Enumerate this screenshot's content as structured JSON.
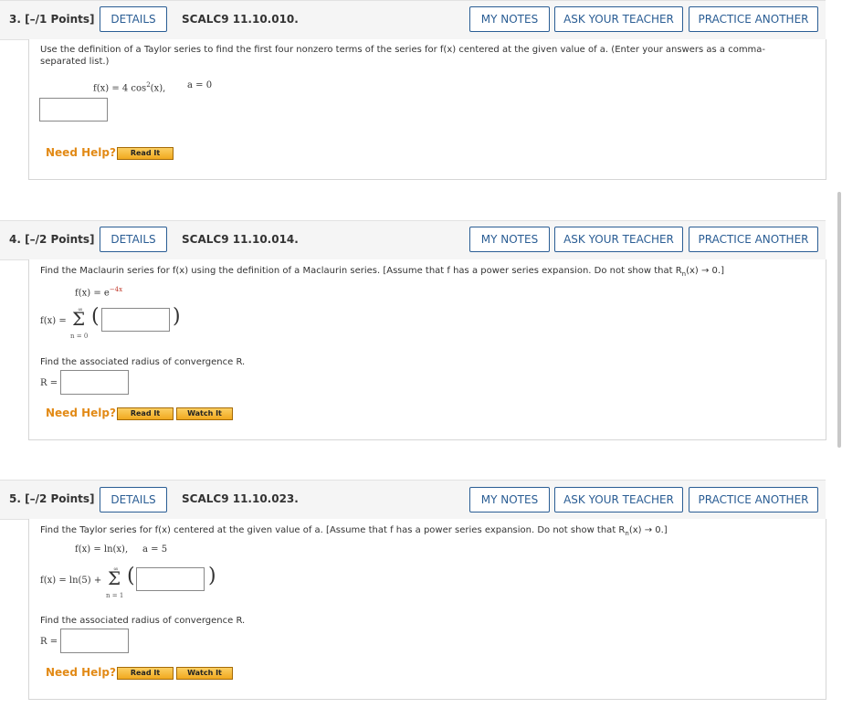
{
  "q3": {
    "num": "3.  [–/1 Points]",
    "details": "DETAILS",
    "code": "SCALC9 11.10.010.",
    "my_notes": "MY NOTES",
    "ask": "ASK YOUR TEACHER",
    "practice": "PRACTICE ANOTHER",
    "instr": "Use the definition of a Taylor series to find the first four nonzero terms of the series for f(x) centered at the given value of a. (Enter your answers as a comma-separated list.)",
    "fx_pre": "f(x) = 4 cos",
    "fx_sup": "2",
    "fx_post": "(x),",
    "a": "a = 0",
    "need_help": "Need Help?",
    "read_it": "Read It"
  },
  "q4": {
    "num": "4.  [–/2 Points]",
    "details": "DETAILS",
    "code": "SCALC9 11.10.014.",
    "my_notes": "MY NOTES",
    "ask": "ASK YOUR TEACHER",
    "practice": "PRACTICE ANOTHER",
    "instr": "Find the Maclaurin series for f(x) using the definition of a Maclaurin series. [Assume that f has a power series expansion. Do not show that R",
    "instr_sub": "n",
    "instr_end": "(x) → 0.]",
    "fx": "f(x) = e",
    "fx_sup": "−4x",
    "sum_lhs": "f(x) =",
    "sum_top": "∞",
    "sum_bottom": "n = 0",
    "radius_text": "Find the associated radius of convergence R.",
    "r_label": "R =",
    "need_help": "Need Help?",
    "read_it": "Read It",
    "watch_it": "Watch It"
  },
  "q5": {
    "num": "5.  [–/2 Points]",
    "details": "DETAILS",
    "code": "SCALC9 11.10.023.",
    "my_notes": "MY NOTES",
    "ask": "ASK YOUR TEACHER",
    "practice": "PRACTICE ANOTHER",
    "instr": "Find the Taylor series for f(x) centered at the given value of a. [Assume that f has a power series expansion. Do not show that R",
    "instr_sub": "n",
    "instr_end": "(x) → 0.]",
    "fx": "f(x) = ln(x),",
    "a": "a = 5",
    "sum_lhs": "f(x) = ln(5) +",
    "sum_top": "∞",
    "sum_bottom": "n = 1",
    "radius_text": "Find the associated radius of convergence R.",
    "r_label": "R =",
    "need_help": "Need Help?",
    "read_it": "Read It",
    "watch_it": "Watch It"
  }
}
